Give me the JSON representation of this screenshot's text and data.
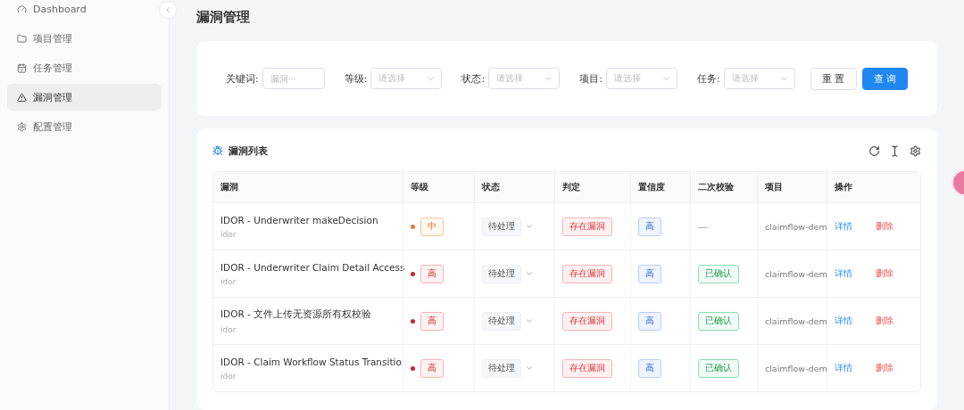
{
  "sidebar": {
    "items": [
      {
        "label": "Dashboard",
        "selected": false
      },
      {
        "label": "项目管理",
        "selected": false
      },
      {
        "label": "任务管理",
        "selected": false
      },
      {
        "label": "漏洞管理",
        "selected": true
      },
      {
        "label": "配置管理",
        "selected": false
      }
    ]
  },
  "page_title": "漏洞管理",
  "filters": [
    {
      "label": "关键词:",
      "kind": "input",
      "placeholder": "漏洞···"
    },
    {
      "label": "等级:",
      "kind": "select",
      "placeholder": "请选择"
    },
    {
      "label": "状态:",
      "kind": "select",
      "placeholder": "请选择"
    },
    {
      "label": "项目:",
      "kind": "select",
      "placeholder": "请选择"
    },
    {
      "label": "任务:",
      "kind": "select",
      "placeholder": "请选择"
    }
  ],
  "filter_buttons": [
    {
      "label": "重 置",
      "kind": "default"
    },
    {
      "label": "查 询",
      "kind": "primary"
    }
  ],
  "table": {
    "title": "漏洞列表",
    "columns": [
      "漏洞",
      "等级",
      "状态",
      "判定",
      "置信度",
      "二次校验",
      "项目",
      "操作"
    ],
    "rows": [
      {
        "name": "IDOR - Underwriter makeDecision",
        "type": "idor",
        "level": "中",
        "color": "#e8772e",
        "status": "待处理",
        "verdict": "存在漏洞",
        "confidence": "高",
        "recheck": "—",
        "recheck_confirmed": false,
        "project": "claimflow-dem",
        "actions": [
          "详情",
          "删除"
        ]
      },
      {
        "name": "IDOR - Underwriter Claim Detail Access",
        "type": "idor",
        "level": "高",
        "color": "#c9252b",
        "status": "待处理",
        "verdict": "存在漏洞",
        "confidence": "高",
        "recheck": "已确认",
        "recheck_confirmed": true,
        "project": "claimflow-dem",
        "actions": [
          "详情",
          "删除"
        ]
      },
      {
        "name": "IDOR - 文件上传无资源所有权校验",
        "type": "idor",
        "level": "高",
        "color": "#c9252b",
        "status": "待处理",
        "verdict": "存在漏洞",
        "confidence": "高",
        "recheck": "已确认",
        "recheck_confirmed": true,
        "project": "claimflow-dem",
        "actions": [
          "详情",
          "删除"
        ]
      },
      {
        "name": "IDOR - Claim Workflow Status Transitio",
        "type": "idor",
        "level": "高",
        "color": "#c9252b",
        "status": "待处理",
        "verdict": "存在漏洞",
        "confidence": "高",
        "recheck": "已确认",
        "recheck_confirmed": true,
        "project": "claimflow-dem",
        "actions": [
          "详情",
          "删除"
        ]
      }
    ]
  }
}
